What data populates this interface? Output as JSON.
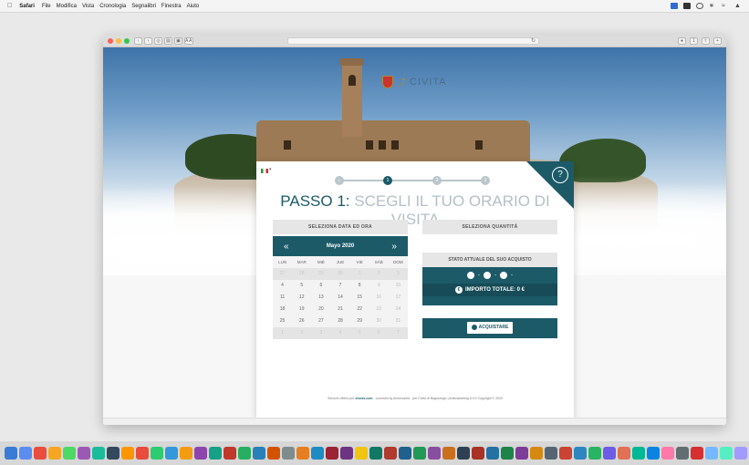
{
  "menubar": {
    "app": "Safari",
    "items": [
      "File",
      "Modifica",
      "Vista",
      "Cronologia",
      "Segnalibri",
      "Finestra",
      "Aiuto"
    ]
  },
  "browser": {
    "toolbar": {
      "reader": "A A"
    }
  },
  "site": {
    "logo_text": "CIVITA",
    "help_label": "?",
    "steps": [
      "1",
      "2",
      "3"
    ],
    "title": {
      "prefix": "PASSO 1:",
      "rest": "SCEGLI IL TUO ORARIO DI VISITA"
    },
    "left_header": "SELEZIONA DATA ED ORA",
    "right_header": "SELEZIONA QUANTITÁ",
    "calendar": {
      "month_label": "Mayo 2020",
      "prev": "«",
      "next": "»",
      "weekdays": [
        "LUN",
        "MAR",
        "MIÉ",
        "JUE",
        "VIE",
        "SÁB",
        "DOM"
      ],
      "rows": [
        [
          "27",
          "28",
          "29",
          "30",
          "1",
          "2",
          "3"
        ],
        [
          "4",
          "5",
          "6",
          "7",
          "8",
          "9",
          "10"
        ],
        [
          "11",
          "12",
          "13",
          "14",
          "15",
          "16",
          "17"
        ],
        [
          "18",
          "19",
          "20",
          "21",
          "22",
          "23",
          "24"
        ],
        [
          "25",
          "26",
          "27",
          "28",
          "29",
          "30",
          "31"
        ],
        [
          "1",
          "2",
          "3",
          "4",
          "5",
          "6",
          "7"
        ]
      ]
    },
    "status": {
      "header": "STATO ATTUALE DEL SUO ACQUISTO",
      "total_label": "IMPORTO TOTALE: 0 €",
      "buy_label": "ACQUISTARE"
    },
    "footer": {
      "prefix": "Servizio offerto per",
      "link": "vivoss.com",
      "rest": " - Licensed by Archeoarea - per Civita di Bagnoregio | Artsmarketing 6.0.0 Copyright © 2020"
    }
  },
  "colors": {
    "brand": "#1c5a68",
    "step_inactive": "#b9c6cb",
    "title_light": "#b4c0c6"
  }
}
